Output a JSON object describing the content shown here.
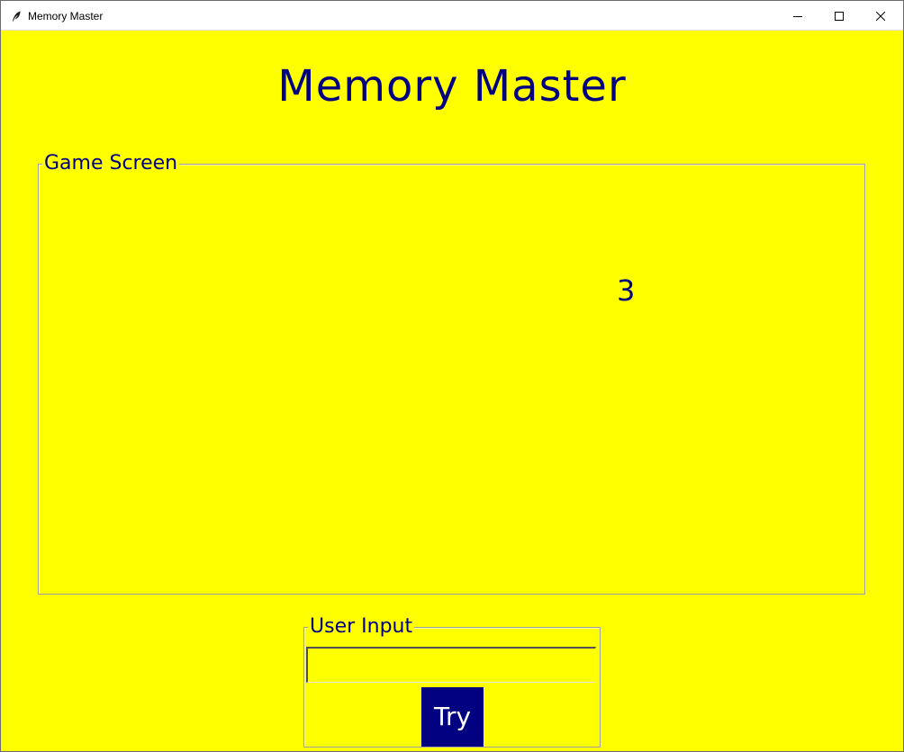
{
  "window": {
    "title": "Memory Master",
    "icon": "feather-icon",
    "controls": [
      "minimize-icon",
      "maximize-icon",
      "close-icon"
    ]
  },
  "app": {
    "heading": "Memory Master",
    "colors": {
      "background": "#ffff00",
      "text": "#000080",
      "button_bg": "#000080",
      "button_text": "#ffffff"
    }
  },
  "game_screen": {
    "label": "Game Screen",
    "displayed_number": "3"
  },
  "user_input": {
    "label": "User Input",
    "value": "",
    "button_label": "Try"
  }
}
